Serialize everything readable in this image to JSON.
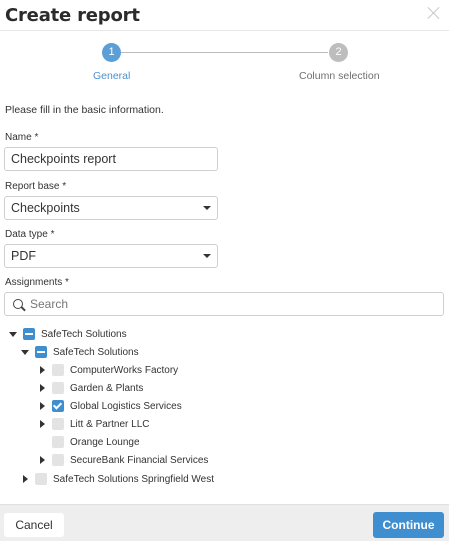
{
  "dialog": {
    "title": "Create report"
  },
  "stepper": {
    "steps": [
      {
        "number": "1",
        "label": "General"
      },
      {
        "number": "2",
        "label": "Column selection"
      }
    ]
  },
  "form": {
    "intro": "Please fill in the basic information.",
    "name": {
      "label": "Name *",
      "value": "Checkpoints report"
    },
    "report_base": {
      "label": "Report base *",
      "value": "Checkpoints"
    },
    "data_type": {
      "label": "Data type *",
      "value": "PDF"
    },
    "assignments": {
      "label": "Assignments *",
      "search_placeholder": "Search"
    }
  },
  "tree": [
    {
      "label": "SafeTech Solutions",
      "state": "partial",
      "expander": "expanded"
    },
    {
      "label": "SafeTech Solutions",
      "state": "partial",
      "expander": "expanded"
    },
    {
      "label": "ComputerWorks Factory",
      "state": "unchecked",
      "expander": "collapsed"
    },
    {
      "label": "Garden & Plants",
      "state": "unchecked",
      "expander": "collapsed"
    },
    {
      "label": "Global Logistics Services",
      "state": "checked",
      "expander": "collapsed"
    },
    {
      "label": "Litt & Partner LLC",
      "state": "unchecked",
      "expander": "collapsed"
    },
    {
      "label": "Orange Lounge",
      "state": "unchecked",
      "expander": "none"
    },
    {
      "label": "SecureBank Financial Services",
      "state": "unchecked",
      "expander": "collapsed"
    },
    {
      "label": "SafeTech Solutions Springfield West",
      "state": "unchecked",
      "expander": "collapsed"
    }
  ],
  "footer": {
    "cancel_label": "Cancel",
    "continue_label": "Continue"
  },
  "colors": {
    "accent": "#3f8fd0",
    "step_active": "#5b9fd6",
    "step_inactive": "#bdbdbd"
  }
}
